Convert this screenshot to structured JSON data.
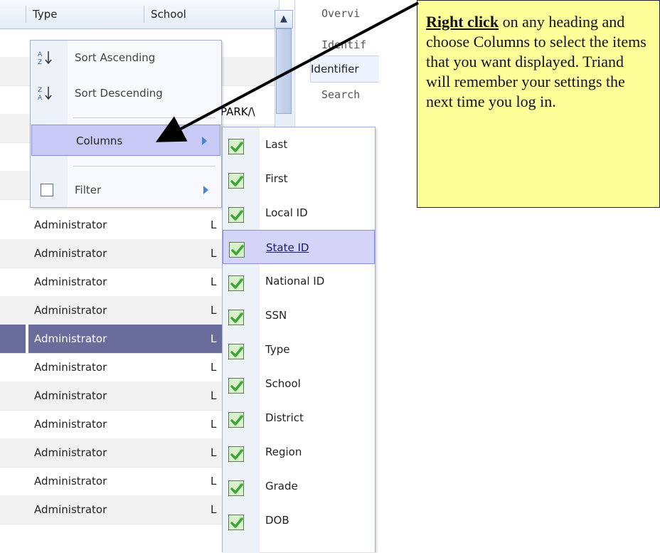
{
  "grid": {
    "headers": {
      "type": "Type",
      "school": "School"
    },
    "rows": [
      {
        "type": "Administrator",
        "trunc": "L"
      },
      {
        "type": "Administrator",
        "trunc": "L"
      },
      {
        "type": "Administrator",
        "trunc": "L"
      },
      {
        "type": "Administrator",
        "trunc": "L"
      },
      {
        "type": "Administrator",
        "trunc": "L"
      },
      {
        "type": "Administrator",
        "trunc": "L"
      },
      {
        "type": "Administrator",
        "trunc": "L"
      },
      {
        "type": "Administrator",
        "trunc": "L"
      },
      {
        "type": "Administrator",
        "trunc": "L"
      },
      {
        "type": "Administrator",
        "trunc": "L"
      },
      {
        "type": "Administrator",
        "trunc": "L"
      }
    ],
    "fragment": "PARK/\\"
  },
  "side_panel": {
    "overview": "Overvi",
    "identif": "Identif",
    "identifier_tab": "Identifier",
    "search": "Search"
  },
  "context_menu": {
    "sort_ascending": "Sort Ascending",
    "sort_descending": "Sort Descending",
    "columns": "Columns",
    "filter": "Filter"
  },
  "columns_submenu": [
    {
      "label": "Last",
      "checked": true
    },
    {
      "label": "First",
      "checked": true
    },
    {
      "label": "Local ID",
      "checked": true
    },
    {
      "label": "State ID",
      "checked": true
    },
    {
      "label": "National ID",
      "checked": true
    },
    {
      "label": "SSN",
      "checked": true
    },
    {
      "label": "Type",
      "checked": true
    },
    {
      "label": "School",
      "checked": true
    },
    {
      "label": "District",
      "checked": true
    },
    {
      "label": "Region",
      "checked": true
    },
    {
      "label": "Grade",
      "checked": true
    },
    {
      "label": "DOB",
      "checked": true
    }
  ],
  "callout": {
    "bold": "Right click",
    "text": " on any heading and choose Columns to select the items that you want displayed.  Triand will remember your settings the next time you log in."
  },
  "colors": {
    "selected_row": "#6a6d9c",
    "menu_highlight": "#c9c9f5",
    "callout_bg": "#ffff99",
    "check_green": "#3aa835"
  }
}
